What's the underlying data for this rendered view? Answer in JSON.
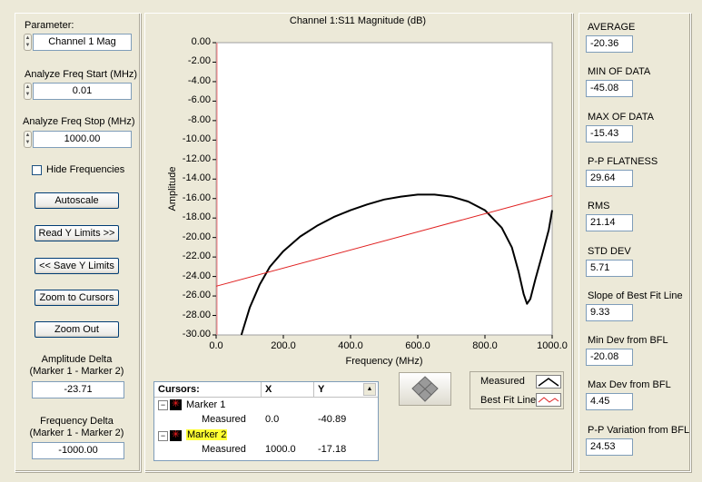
{
  "left": {
    "parameter_label": "Parameter:",
    "parameter_value": "Channel 1 Mag",
    "freq_start_label": "Analyze Freq Start (MHz)",
    "freq_start_value": "0.01",
    "freq_stop_label": "Analyze Freq Stop (MHz)",
    "freq_stop_value": "1000.00",
    "hide_freq_label": "Hide Frequencies",
    "autoscale_label": "Autoscale",
    "read_y_limits_label": "Read Y Limits >>",
    "save_y_limits_label": "<< Save Y Limits",
    "zoom_cursors_label": "Zoom to Cursors",
    "zoom_out_label": "Zoom Out",
    "amp_delta_label1": "Amplitude Delta",
    "amp_delta_label2": "(Marker 1 - Marker 2)",
    "amp_delta_value": "-23.71",
    "freq_delta_label1": "Frequency Delta",
    "freq_delta_label2": "(Marker 1 - Marker 2)",
    "freq_delta_value": "-1000.00"
  },
  "chart_data": {
    "type": "line",
    "title": "Channel 1:S11 Magnitude (dB)",
    "xlabel": "Frequency (MHz)",
    "ylabel": "Amplitude",
    "xlim": [
      0,
      1000
    ],
    "ylim": [
      -30,
      0
    ],
    "yticks": [
      "0.00",
      "-2.00",
      "-4.00",
      "-6.00",
      "-8.00",
      "-10.00",
      "-12.00",
      "-14.00",
      "-16.00",
      "-18.00",
      "-20.00",
      "-22.00",
      "-24.00",
      "-26.00",
      "-28.00",
      "-30.00"
    ],
    "xticks": [
      "0.0",
      "200.0",
      "400.0",
      "600.0",
      "800.0",
      "1000.0"
    ],
    "grid": false,
    "series": [
      {
        "name": "Measured",
        "color": "#000000",
        "x": [
          75,
          100,
          130,
          160,
          200,
          250,
          300,
          350,
          400,
          450,
          500,
          550,
          600,
          650,
          700,
          750,
          800,
          850,
          880,
          900,
          915,
          925,
          935,
          950,
          970,
          990,
          1000
        ],
        "y": [
          -30.0,
          -27.2,
          -24.8,
          -23.0,
          -21.4,
          -19.9,
          -18.8,
          -17.9,
          -17.2,
          -16.6,
          -16.1,
          -15.8,
          -15.6,
          -15.6,
          -15.8,
          -16.3,
          -17.2,
          -19.0,
          -21.0,
          -23.5,
          -25.8,
          -26.8,
          -26.3,
          -24.3,
          -21.8,
          -19.2,
          -17.2
        ]
      },
      {
        "name": "Best Fit Line",
        "color": "#e02020",
        "x": [
          0,
          1000
        ],
        "y": [
          -25.0,
          -15.7
        ]
      }
    ]
  },
  "cursors": {
    "header": "Cursors:",
    "col_x": "X",
    "col_y": "Y",
    "rows": [
      {
        "name": "Marker 1",
        "measured_label": "Measured",
        "x": "0.0",
        "y": "-40.89"
      },
      {
        "name": "Marker 2",
        "measured_label": "Measured",
        "x": "1000.0",
        "y": "-17.18"
      }
    ]
  },
  "legend": {
    "measured": "Measured",
    "best_fit": "Best Fit Line"
  },
  "stats": [
    {
      "label": "AVERAGE",
      "value": "-20.36"
    },
    {
      "label": "MIN OF DATA",
      "value": "-45.08"
    },
    {
      "label": "MAX OF DATA",
      "value": "-15.43"
    },
    {
      "label": "P-P FLATNESS",
      "value": "29.64"
    },
    {
      "label": "RMS",
      "value": "21.14"
    },
    {
      "label": "STD DEV",
      "value": "5.71"
    },
    {
      "label": "Slope of Best Fit Line",
      "value": "9.33"
    },
    {
      "label": "Min Dev from BFL",
      "value": "-20.08"
    },
    {
      "label": "Max Dev from BFL",
      "value": "4.45"
    },
    {
      "label": "P-P Variation from BFL",
      "value": "24.53"
    }
  ]
}
